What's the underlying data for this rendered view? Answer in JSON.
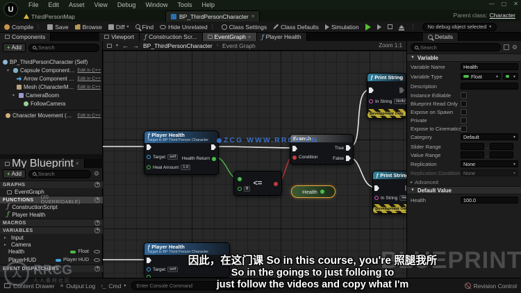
{
  "window": {
    "menus": [
      "File",
      "Edit",
      "Asset",
      "View",
      "Debug",
      "Window",
      "Tools",
      "Help"
    ],
    "level_tab": "ThirdPersonMap",
    "doc_tab": "BP_ThirdPersonCharacter",
    "parent_class": {
      "label": "Parent class:",
      "value": "Character"
    }
  },
  "toolbar": {
    "compile": "Compile",
    "save": "Save",
    "browse": "Browse",
    "diff": "Diff",
    "find": "Find",
    "hide_unrelated": "Hide Unrelated",
    "class_settings": "Class Settings",
    "class_defaults": "Class Defaults",
    "simulation": "Simulation",
    "debug_object": "No debug object selected"
  },
  "components": {
    "tab": "Components",
    "add": "Add",
    "search": "Search",
    "rows": [
      {
        "label": "BP_ThirdPersonCharacter (Self)"
      },
      {
        "label": "Capsule Component (CollisionCylinder)",
        "edit": "Edit in C++"
      },
      {
        "label": "Arrow Component (Arrow)",
        "edit": "Edit in C++"
      },
      {
        "label": "Mesh (CharacterMesh0)",
        "edit": "Edit in C++"
      },
      {
        "label": "CameraBoom"
      },
      {
        "label": "FollowCamera"
      },
      {
        "label": "Character Movement (CharMoveComp)",
        "edit": "Edit in C++"
      }
    ]
  },
  "my_blueprint": {
    "tab": "My Blueprint",
    "add": "Add",
    "search": "Search",
    "graphs_header": "GRAPHS",
    "event_graph": "EventGraph",
    "functions_header": "FUNCTIONS",
    "functions_badge": "(20 OVERRIDABLE)",
    "construction_script": "ConstructionScript",
    "player_health_fn": "Player Health",
    "macros_header": "MACROS",
    "variables_header": "VARIABLES",
    "category_input": "Input",
    "category_camera": "Camera",
    "var_health": {
      "name": "Health",
      "type": "Float"
    },
    "var_playerhud": {
      "name": "PlayerHUD",
      "type": "Player HUD"
    },
    "dispatchers_header": "EVENT DISPATCHERS"
  },
  "graph": {
    "tabs": [
      "Viewport",
      "Construction Scr...",
      "EventGraph",
      "Player Health"
    ],
    "breadcrumb": {
      "root": "BP_ThirdPersonCharacter",
      "current": "Event Graph"
    },
    "zoom": "Zoom 1:1",
    "nodes": {
      "heal_call": {
        "title": "Player Health",
        "subtitle": "Target is BP Third Person Character",
        "target_label": "Target",
        "target_value": "self",
        "amount_label": "Heal Amount",
        "amount_value": "1.0",
        "output_label": "Health Return"
      },
      "health_var": {
        "label": "Health"
      },
      "compare": {
        "operator": "<=",
        "value": "0"
      },
      "branch": {
        "title": "Branch",
        "condition": "Condition",
        "true": "True",
        "false": "False"
      },
      "print1": {
        "title": "Print String",
        "in_string": "In String",
        "value": "Hello",
        "dev_only": "Development Only"
      },
      "print2": {
        "title": "Print String",
        "in_string": "In String",
        "value": "Hello",
        "dev_only": "Development Only"
      },
      "heal_call2": {
        "title": "Player Health",
        "subtitle": "Target is BP Third Person Character",
        "target_label": "Target",
        "target_value": "self"
      }
    }
  },
  "details": {
    "tab": "Details",
    "search": "Search",
    "variable_section": "Variable",
    "rows": {
      "variable_name": {
        "label": "Variable Name",
        "value": "Health"
      },
      "variable_type": {
        "label": "Variable Type",
        "value": "Float"
      },
      "description": {
        "label": "Description"
      },
      "instance_editable": {
        "label": "Instance Editable"
      },
      "blueprint_read_only": {
        "label": "Blueprint Read Only"
      },
      "expose_on_spawn": {
        "label": "Expose on Spawn"
      },
      "private": {
        "label": "Private"
      },
      "expose_to_cinematics": {
        "label": "Expose to Cinematics"
      },
      "category": {
        "label": "Category",
        "value": "Default"
      },
      "slider_range": {
        "label": "Slider Range"
      },
      "value_range": {
        "label": "Value Range"
      },
      "replication": {
        "label": "Replication",
        "value": "None"
      },
      "replication_condition": {
        "label": "Replication Condition",
        "value": "None"
      },
      "advanced": "Advanced",
      "default_section": "Default Value",
      "default_health": {
        "label": "Health",
        "value": "100.0"
      }
    }
  },
  "status_bar": {
    "content_drawer": "Content Drawer",
    "output_log": "Output Log",
    "cmd": "Cmd",
    "console_placeholder": "Enter Console Command",
    "revision_control": "Revision Control"
  },
  "subtitles": {
    "line1": "因此，在这门课  So in this course, you're  照腿我所",
    "line2": "So in the goings to just folloing to",
    "line3": "just follow the videos and copy what I'm"
  },
  "watermarks": {
    "graph_text": "ZCG WWW.RRCG.CN",
    "blueprint": "BLUEPRINT",
    "logo_title": "RRCG",
    "logo_subtitle": "人人素材社区"
  },
  "colors": {
    "exec": "#e8e8e8",
    "float_pin": "#4cbb4c",
    "bool_pin": "#c23c3c",
    "object_pin": "#3fa7e0",
    "string_pin": "#e05bc3",
    "selection": "#e8a33d",
    "watermark_blue": "#3c76d0"
  }
}
